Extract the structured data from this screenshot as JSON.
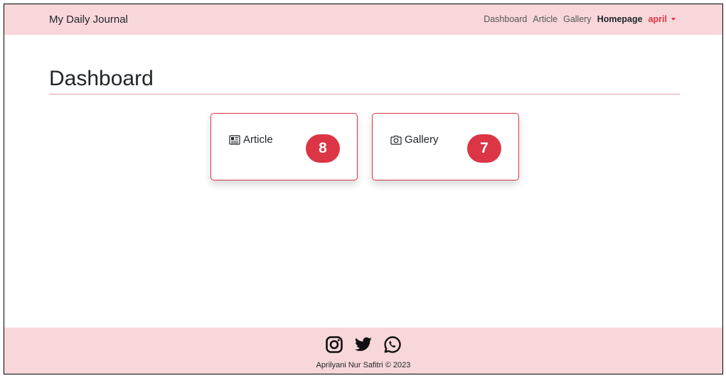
{
  "navbar": {
    "brand": "My Daily Journal",
    "links": [
      "Dashboard",
      "Article",
      "Gallery",
      "Homepage"
    ],
    "user": "april"
  },
  "main": {
    "title": "Dashboard",
    "cards": [
      {
        "label": "Article",
        "count": "8",
        "icon": "newspaper-icon"
      },
      {
        "label": "Gallery",
        "count": "7",
        "icon": "camera-icon"
      }
    ]
  },
  "footer": {
    "icons": [
      "instagram-icon",
      "twitter-icon",
      "whatsapp-icon"
    ],
    "copyright": "Aprilyani Nur Safitri © 2023"
  },
  "colors": {
    "accent": "#dc3545",
    "bar": "#f8d7da"
  }
}
